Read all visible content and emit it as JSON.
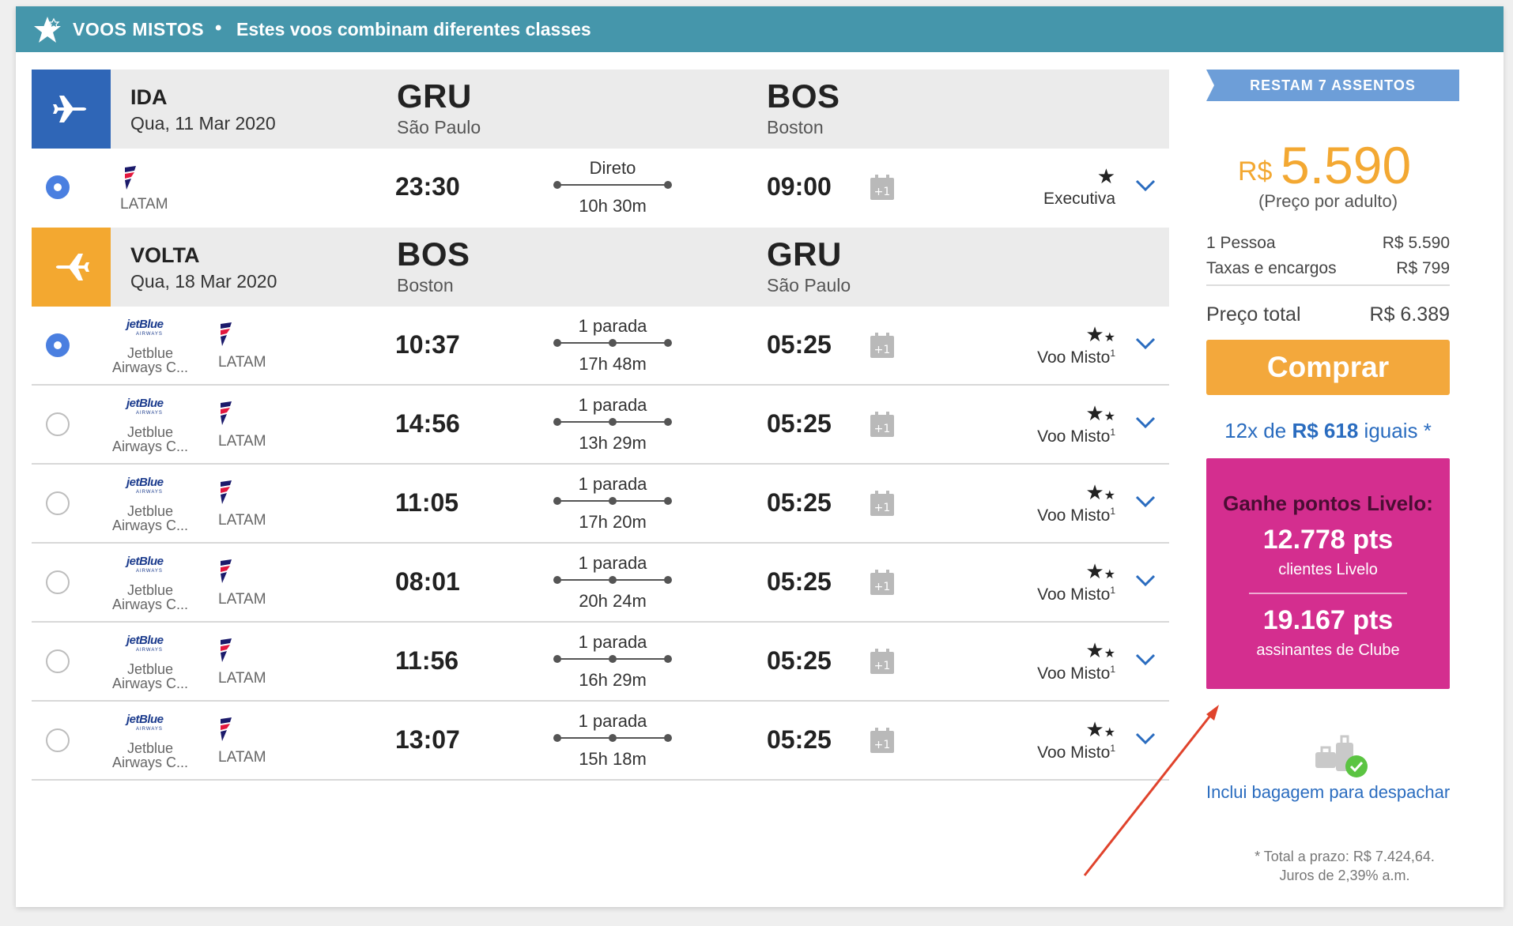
{
  "header": {
    "title": "VOOS MISTOS",
    "separator": "•",
    "subtitle": "Estes voos combinam diferentes classes"
  },
  "outbound": {
    "direction": "IDA",
    "date": "Qua, 11 Mar 2020",
    "origin_code": "GRU",
    "origin_city": "São Paulo",
    "dest_code": "BOS",
    "dest_city": "Boston",
    "color": "#2f66b7",
    "flights": [
      {
        "selected": true,
        "airline": "LATAM",
        "depart": "23:30",
        "stops": "Direto",
        "duration": "10h 30m",
        "arrive": "09:00",
        "cal_badge": "+1",
        "class_label": "Executiva",
        "class_icon": "star-icon"
      }
    ]
  },
  "return": {
    "direction": "VOLTA",
    "date": "Qua, 18 Mar 2020",
    "origin_code": "BOS",
    "origin_city": "Boston",
    "dest_code": "GRU",
    "dest_city": "São Paulo",
    "color": "#f3a830",
    "flights": [
      {
        "selected": true,
        "airline1_logo": "jetBlue",
        "airline1_logo_sub": "AIRWAYS",
        "airline1": "Jetblue Airways C...",
        "airline2": "LATAM",
        "depart": "10:37",
        "stops": "1 parada",
        "duration": "17h 48m",
        "arrive": "05:25",
        "cal_badge": "+1",
        "class_label": "Voo Misto",
        "class_sup": "1"
      },
      {
        "selected": false,
        "airline1_logo": "jetBlue",
        "airline1_logo_sub": "AIRWAYS",
        "airline1": "Jetblue Airways C...",
        "airline2": "LATAM",
        "depart": "14:56",
        "stops": "1 parada",
        "duration": "13h 29m",
        "arrive": "05:25",
        "cal_badge": "+1",
        "class_label": "Voo Misto",
        "class_sup": "1"
      },
      {
        "selected": false,
        "airline1_logo": "jetBlue",
        "airline1_logo_sub": "AIRWAYS",
        "airline1": "Jetblue Airways C...",
        "airline2": "LATAM",
        "depart": "11:05",
        "stops": "1 parada",
        "duration": "17h 20m",
        "arrive": "05:25",
        "cal_badge": "+1",
        "class_label": "Voo Misto",
        "class_sup": "1"
      },
      {
        "selected": false,
        "airline1_logo": "jetBlue",
        "airline1_logo_sub": "AIRWAYS",
        "airline1": "Jetblue Airways C...",
        "airline2": "LATAM",
        "depart": "08:01",
        "stops": "1 parada",
        "duration": "20h 24m",
        "arrive": "05:25",
        "cal_badge": "+1",
        "class_label": "Voo Misto",
        "class_sup": "1"
      },
      {
        "selected": false,
        "airline1_logo": "jetBlue",
        "airline1_logo_sub": "AIRWAYS",
        "airline1": "Jetblue Airways C...",
        "airline2": "LATAM",
        "depart": "11:56",
        "stops": "1 parada",
        "duration": "16h 29m",
        "arrive": "05:25",
        "cal_badge": "+1",
        "class_label": "Voo Misto",
        "class_sup": "1"
      },
      {
        "selected": false,
        "airline1_logo": "jetBlue",
        "airline1_logo_sub": "AIRWAYS",
        "airline1": "Jetblue Airways C...",
        "airline2": "LATAM",
        "depart": "13:07",
        "stops": "1 parada",
        "duration": "15h 18m",
        "arrive": "05:25",
        "cal_badge": "+1",
        "class_label": "Voo Misto",
        "class_sup": "1"
      }
    ]
  },
  "summary": {
    "seats_ribbon": "RESTAM 7 ASSENTOS",
    "currency": "R$",
    "price": "5.590",
    "price_note": "(Preço por adulto)",
    "lines": [
      {
        "label": "1 Pessoa",
        "value": "R$ 5.590"
      },
      {
        "label": "Taxas e encargos",
        "value": "R$ 799"
      }
    ],
    "total_label": "Preço total",
    "total_value": "R$ 6.389",
    "buy_label": "Comprar",
    "installments_prefix": "12x de",
    "installments_value": "R$ 618",
    "installments_suffix": "iguais *",
    "livelo": {
      "heading": "Ganhe pontos Livelo:",
      "points_1": "12.778 pts",
      "label_1": "clientes Livelo",
      "points_2": "19.167 pts",
      "label_2": "assinantes de Clube"
    },
    "baggage_text": "Inclui bagagem para despachar",
    "footnote_1": "* Total a prazo: R$ 7.424,64.",
    "footnote_2": "Juros de 2,39% a.m."
  }
}
